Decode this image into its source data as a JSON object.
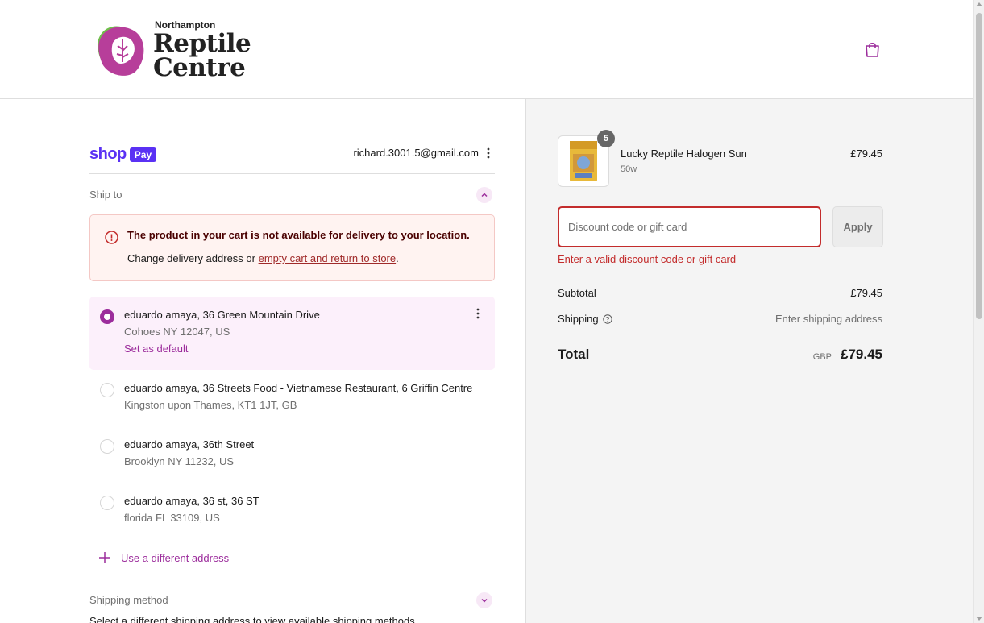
{
  "brand": {
    "small": "Northampton",
    "line1": "Reptile",
    "line2": "Centre"
  },
  "shoppay": {
    "word": "shop",
    "pill": "Pay",
    "email": "richard.3001.5@gmail.com"
  },
  "ship_to": {
    "label": "Ship to",
    "alert_title": "The product in your cart is not available for delivery to your location.",
    "alert_prefix": "Change delivery address or ",
    "alert_link": "empty cart and return to store",
    "alert_suffix": ".",
    "addresses": [
      {
        "line1": "eduardo amaya, 36 Green Mountain Drive",
        "line2": "Cohoes NY 12047, US",
        "default_link": "Set as default",
        "selected": true
      },
      {
        "line1": "eduardo amaya, 36 Streets Food - Vietnamese Restaurant, 6 Griffin Centre",
        "line2": "Kingston upon Thames, KT1 1JT, GB",
        "selected": false
      },
      {
        "line1": "eduardo amaya, 36th Street",
        "line2": "Brooklyn NY 11232, US",
        "selected": false
      },
      {
        "line1": "eduardo amaya, 36 st, 36 ST",
        "line2": "florida FL 33109, US",
        "selected": false
      }
    ],
    "use_different": "Use a different address"
  },
  "shipping_method": {
    "label": "Shipping method",
    "note": "Select a different shipping address to view available shipping methods"
  },
  "order": {
    "product_name": "Lucky Reptile Halogen Sun",
    "product_variant": "50w",
    "product_price": "£79.45",
    "quantity": "5",
    "discount_placeholder": "Discount code or gift card",
    "apply_label": "Apply",
    "discount_error": "Enter a valid discount code or gift card",
    "subtotal_label": "Subtotal",
    "subtotal_value": "£79.45",
    "shipping_label": "Shipping",
    "shipping_value": "Enter shipping address",
    "total_label": "Total",
    "total_currency": "GBP",
    "total_value": "£79.45"
  },
  "colors": {
    "accent": "#9c2d9c",
    "shoppay": "#5a31f4",
    "error": "#c32c2c"
  }
}
